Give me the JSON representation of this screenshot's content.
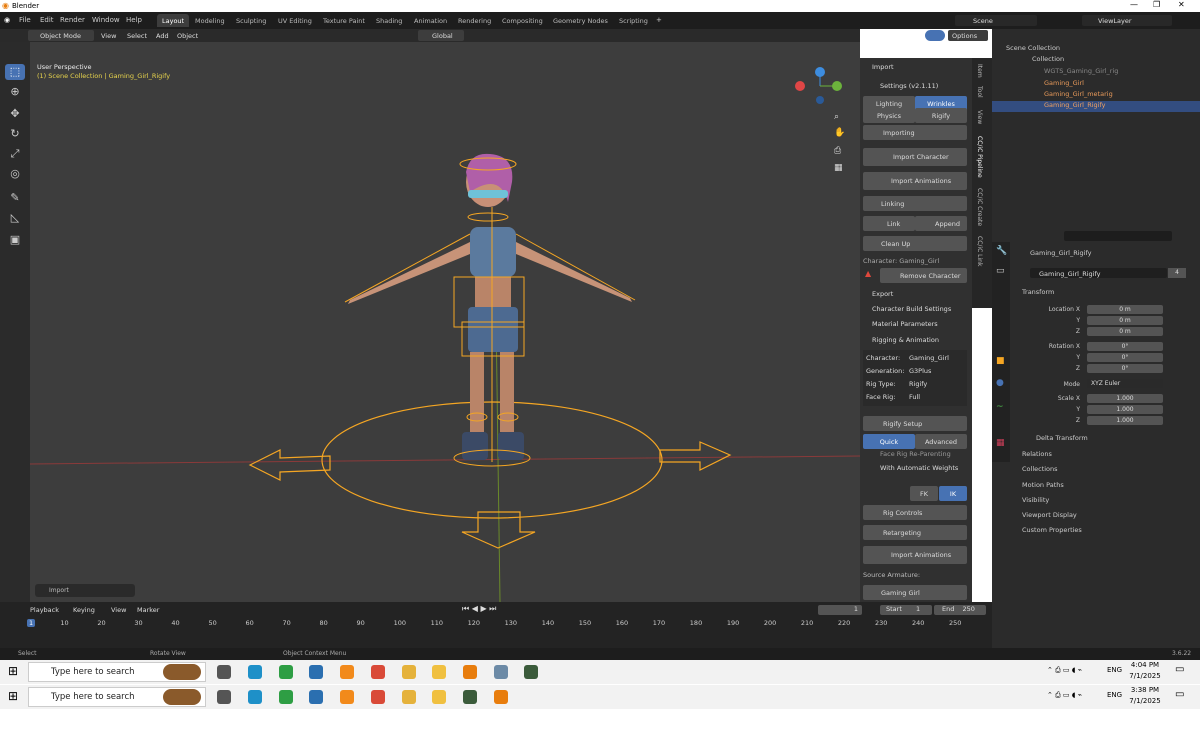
{
  "window": {
    "title": "Blender"
  },
  "menubar": {
    "items": [
      "File",
      "Edit",
      "Render",
      "Window",
      "Help"
    ],
    "workspaces": [
      "Layout",
      "Modeling",
      "Sculpting",
      "UV Editing",
      "Texture Paint",
      "Shading",
      "Animation",
      "Rendering",
      "Compositing",
      "Geometry Nodes",
      "Scripting"
    ],
    "scene": "Scene",
    "view_layer": "ViewLayer"
  },
  "header3d": {
    "mode": "Object Mode",
    "menus": [
      "View",
      "Select",
      "Add",
      "Object"
    ],
    "orientation": "Global",
    "options": "Options"
  },
  "viewport": {
    "perspective": "User Perspective",
    "collection": "(1) Scene Collection | Gaming_Girl_Rigify",
    "last_op": "Import"
  },
  "npanel": {
    "header": "Import",
    "settings": "Settings (v2.1.11)",
    "tabs": [
      "Lighting",
      "Wrinkles",
      "Physics",
      "Rigify"
    ],
    "importing": "Importing",
    "import_character": "Import Character",
    "import_animations": "Import Animations",
    "linking": "Linking",
    "link": "Link",
    "append": "Append",
    "clean_up": "Clean Up",
    "character_label": "Character: Gaming_Girl",
    "remove_character": "Remove Character",
    "export": "Export",
    "build_settings": "Character Build Settings",
    "material_params": "Material Parameters",
    "rigging": "Rigging & Animation",
    "info": [
      {
        "k": "Character:",
        "v": "Gaming_Girl"
      },
      {
        "k": "Generation:",
        "v": "G3Plus"
      },
      {
        "k": "Rig Type:",
        "v": "Rigify"
      },
      {
        "k": "Face Rig:",
        "v": "Full"
      }
    ],
    "rigify_setup": "Rigify Setup",
    "quick": "Quick",
    "advanced": "Advanced",
    "face_rig": "Face Rig Re-Parenting",
    "auto_weights": "With Automatic Weights",
    "fk": "FK",
    "ik": "IK",
    "rig_controls": "Rig Controls",
    "retargeting": "Retargeting",
    "import_animations2": "Import Animations",
    "source_armature": "Source Armature:",
    "source_value": "Gaming Girl",
    "vtabs": [
      "Item",
      "Tool",
      "View",
      "CC/iC Pipeline",
      "CC/iC Create",
      "CC/iC Link"
    ]
  },
  "outliner": {
    "rows": [
      "Scene Collection",
      "Collection",
      "WGTS_Gaming_Girl_rig",
      "Gaming_Girl",
      "Gaming_Girl_metarig",
      "Gaming_Girl_Rigify"
    ]
  },
  "properties": {
    "search_placeholder": "",
    "breadcrumb": "Gaming_Girl_Rigify",
    "object_name": "Gaming_Girl_Rigify",
    "users": "4",
    "transform": "Transform",
    "location": {
      "label": "Location X",
      "x": "0 m",
      "y": "0 m",
      "z": "0 m"
    },
    "rotation": {
      "label": "Rotation X",
      "x": "0°",
      "y": "0°",
      "z": "0°"
    },
    "mode_label": "Mode",
    "mode": "XYZ Euler",
    "scale": {
      "label": "Scale X",
      "x": "1.000",
      "y": "1.000",
      "z": "1.000"
    },
    "axis_y": "Y",
    "axis_z": "Z",
    "sections": [
      "Delta Transform",
      "Relations",
      "Collections",
      "Motion Paths",
      "Visibility",
      "Viewport Display",
      "Custom Properties"
    ]
  },
  "timeline": {
    "menus": [
      "Playback",
      "Keying",
      "View",
      "Marker"
    ],
    "current_frame": "1",
    "start_label": "Start",
    "start": "1",
    "end_label": "End",
    "end": "250",
    "ticks": [
      "1",
      "10",
      "20",
      "30",
      "40",
      "50",
      "60",
      "70",
      "80",
      "90",
      "100",
      "110",
      "120",
      "130",
      "140",
      "150",
      "160",
      "170",
      "180",
      "190",
      "200",
      "210",
      "220",
      "230",
      "240",
      "250"
    ]
  },
  "statusbar": {
    "select": "Select",
    "rotate": "Rotate View",
    "context": "Object Context Menu",
    "version": "3.6.22"
  },
  "taskbar1": {
    "search": "Type here to search",
    "time": "4:04 PM",
    "date": "7/1/2025",
    "lang": "ENG"
  },
  "taskbar2": {
    "search": "Type here to search",
    "time": "3:38 PM",
    "date": "7/1/2025",
    "lang": "ENG"
  },
  "colors": {
    "accent": "#4772b3",
    "selection": "#f5a623",
    "bg": "#3d3d3d"
  }
}
